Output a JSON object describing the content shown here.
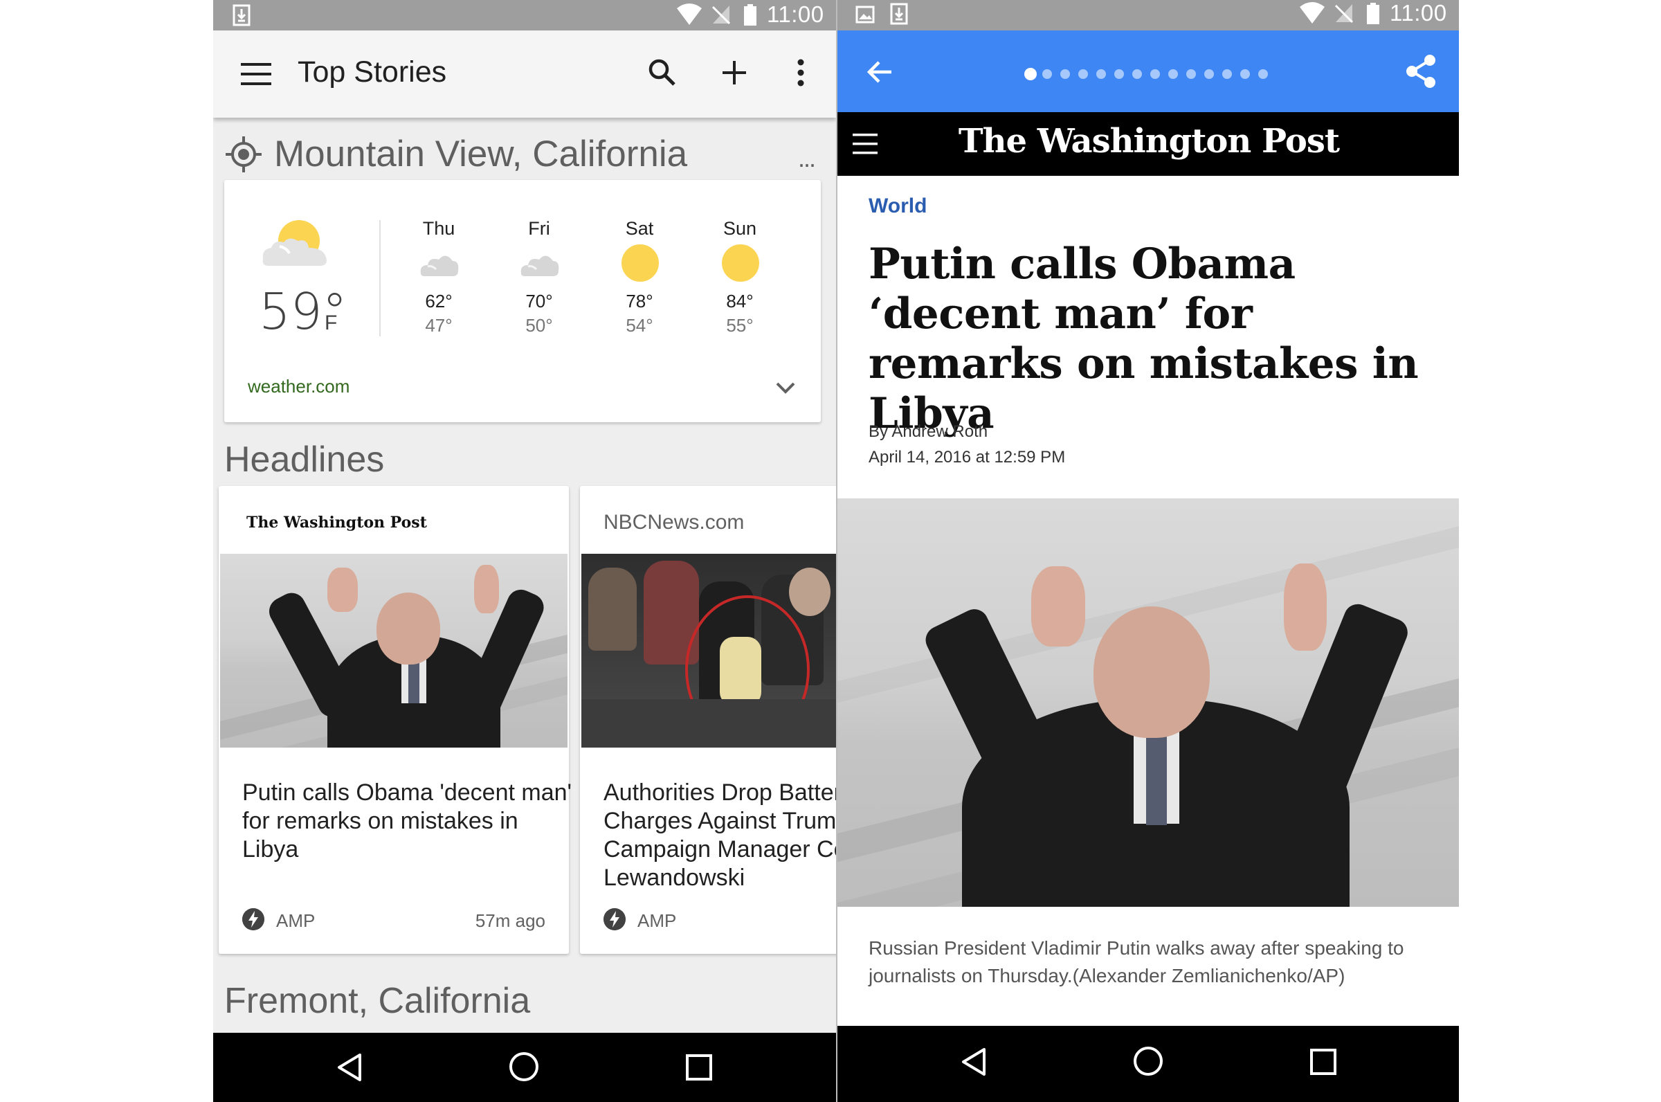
{
  "left": {
    "status": {
      "time": "11:00"
    },
    "appbar": {
      "title": "Top Stories"
    },
    "location": {
      "name": "Mountain View, California",
      "more": "..."
    },
    "weather": {
      "current_temp": "59°",
      "unit": "F",
      "source": "weather.com",
      "days": [
        {
          "name": "Thu",
          "hi": "62°",
          "lo": "47°",
          "icon": "cloudy-icon"
        },
        {
          "name": "Fri",
          "hi": "70°",
          "lo": "50°",
          "icon": "cloudy-icon"
        },
        {
          "name": "Sat",
          "hi": "78°",
          "lo": "54°",
          "icon": "sunny-icon"
        },
        {
          "name": "Sun",
          "hi": "84°",
          "lo": "55°",
          "icon": "sunny-icon"
        }
      ]
    },
    "headlines": {
      "heading": "Headlines",
      "stories": [
        {
          "source": "The Washington Post",
          "title": "Putin calls Obama 'decent man' for remarks on mistakes in Libya",
          "badge": "AMP",
          "time": "57m ago"
        },
        {
          "source": "NBCNews.com",
          "title": "Authorities Drop Battery Charges Against Trump Campaign Manager Corey Lewandowski",
          "badge": "AMP",
          "time": ""
        }
      ]
    },
    "next_location": "Fremont, California"
  },
  "right": {
    "status": {
      "time": "11:00"
    },
    "pager": {
      "count": 14,
      "active": 0
    },
    "masthead": "The Washington Post",
    "article": {
      "kicker": "World",
      "title": "Putin calls Obama ‘decent man’ for remarks on mistakes in Libya",
      "byline": "By Andrew Roth",
      "date": "April 14, 2016 at 12:59 PM",
      "caption": "Russian President Vladimir Putin walks away after speaking to journalists on Thursday.(Alexander Zemlianichenko/AP)"
    }
  },
  "colors": {
    "status_bar": "#9e9e9e",
    "app_bar": "#f5f5f5",
    "share_bar_blue": "#3d86f4",
    "kicker_blue": "#2a5db0",
    "sun_yellow": "#fbd451",
    "weather_source_green": "#33691e"
  }
}
